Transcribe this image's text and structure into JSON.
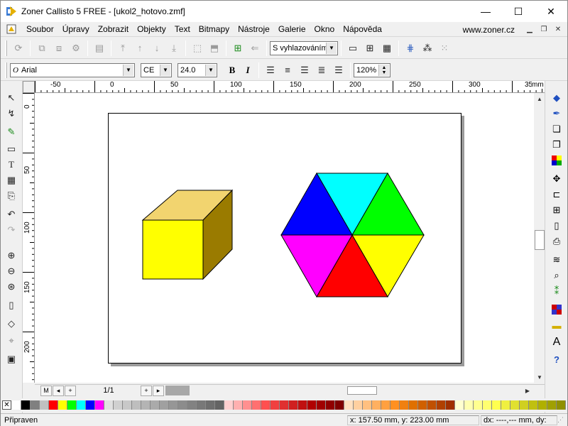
{
  "window": {
    "title": "Zoner Callisto 5 FREE - [ukol2_hotovo.zmf]",
    "minimize": "—",
    "maximize": "☐",
    "close": "✕"
  },
  "menu": {
    "items": [
      "Soubor",
      "Úpravy",
      "Zobrazit",
      "Objekty",
      "Text",
      "Bitmapy",
      "Nástroje",
      "Galerie",
      "Okno",
      "Nápověda"
    ],
    "website": "www.zoner.cz"
  },
  "toolbar": {
    "smoothing_select": "S vyhlazováním",
    "icons": [
      "refresh-icon",
      "group-icon",
      "ungroup-icon",
      "layers-icon",
      "align-icon",
      "move-top-icon",
      "move-up-icon",
      "move-down-icon",
      "move-bottom-icon",
      "combine-icon",
      "break-apart-icon",
      "add-node-icon",
      "arrow-left-icon",
      "monitor-icon",
      "grid-view-icon",
      "table-view-icon",
      "guides-icon",
      "snap-icon",
      "dots-icon"
    ]
  },
  "format": {
    "font": "Arial",
    "charset": "CE",
    "size": "24.0",
    "bold": "B",
    "italic": "I",
    "zoom": "120%"
  },
  "ruler": {
    "unit": "mm",
    "h_ticks": [
      "-50",
      "0",
      "50",
      "100",
      "150",
      "200",
      "250",
      "300",
      "35"
    ],
    "v_ticks": [
      "0",
      "50",
      "100",
      "150",
      "200"
    ]
  },
  "pager": {
    "first": "M",
    "prev": "◂",
    "add_before": "+",
    "info": "1/1",
    "add_after": "+",
    "next": "▸"
  },
  "palette": [
    "#ffffff",
    "#000000",
    "#808080",
    "#c0c0c0",
    "#ff0000",
    "#ffff00",
    "#00ff00",
    "#00ffff",
    "#0000ff",
    "#ff00ff",
    "#e0e0e0",
    "#d0d0d0",
    "#c8c8c8",
    "#bebebe",
    "#b4b4b4",
    "#aaaaaa",
    "#a0a0a0",
    "#969696",
    "#8c8c8c",
    "#828282",
    "#787878",
    "#6e6e6e",
    "#646464",
    "#ffd0d0",
    "#ffb0b0",
    "#ff9090",
    "#ff7070",
    "#ff5050",
    "#f04040",
    "#e03030",
    "#d02020",
    "#c01010",
    "#b00000",
    "#a00000",
    "#900000",
    "#800000",
    "#ffe0c0",
    "#ffd0a0",
    "#ffc080",
    "#ffb060",
    "#ffa040",
    "#ff9020",
    "#f08010",
    "#e07000",
    "#d06000",
    "#c05000",
    "#b04000",
    "#a03000",
    "#ffffd0",
    "#ffffb0",
    "#ffff90",
    "#ffff70",
    "#ffff50",
    "#f0f040",
    "#e0e030",
    "#d0d020",
    "#c0c010",
    "#b0b000",
    "#a0a000",
    "#909000"
  ],
  "status": {
    "state": "Připraven",
    "coords": "x: 157.50 mm, y: 223.00 mm",
    "delta": "dx: ----,--- mm, dy:"
  },
  "drawing": {
    "cube": {
      "front": "#ffff00",
      "top": "#f2d46f",
      "side": "#9a7b00"
    },
    "hexagon": [
      "#00ffff",
      "#00ff00",
      "#ffff00",
      "#ff0000",
      "#ff00ff",
      "#0000ff"
    ]
  }
}
